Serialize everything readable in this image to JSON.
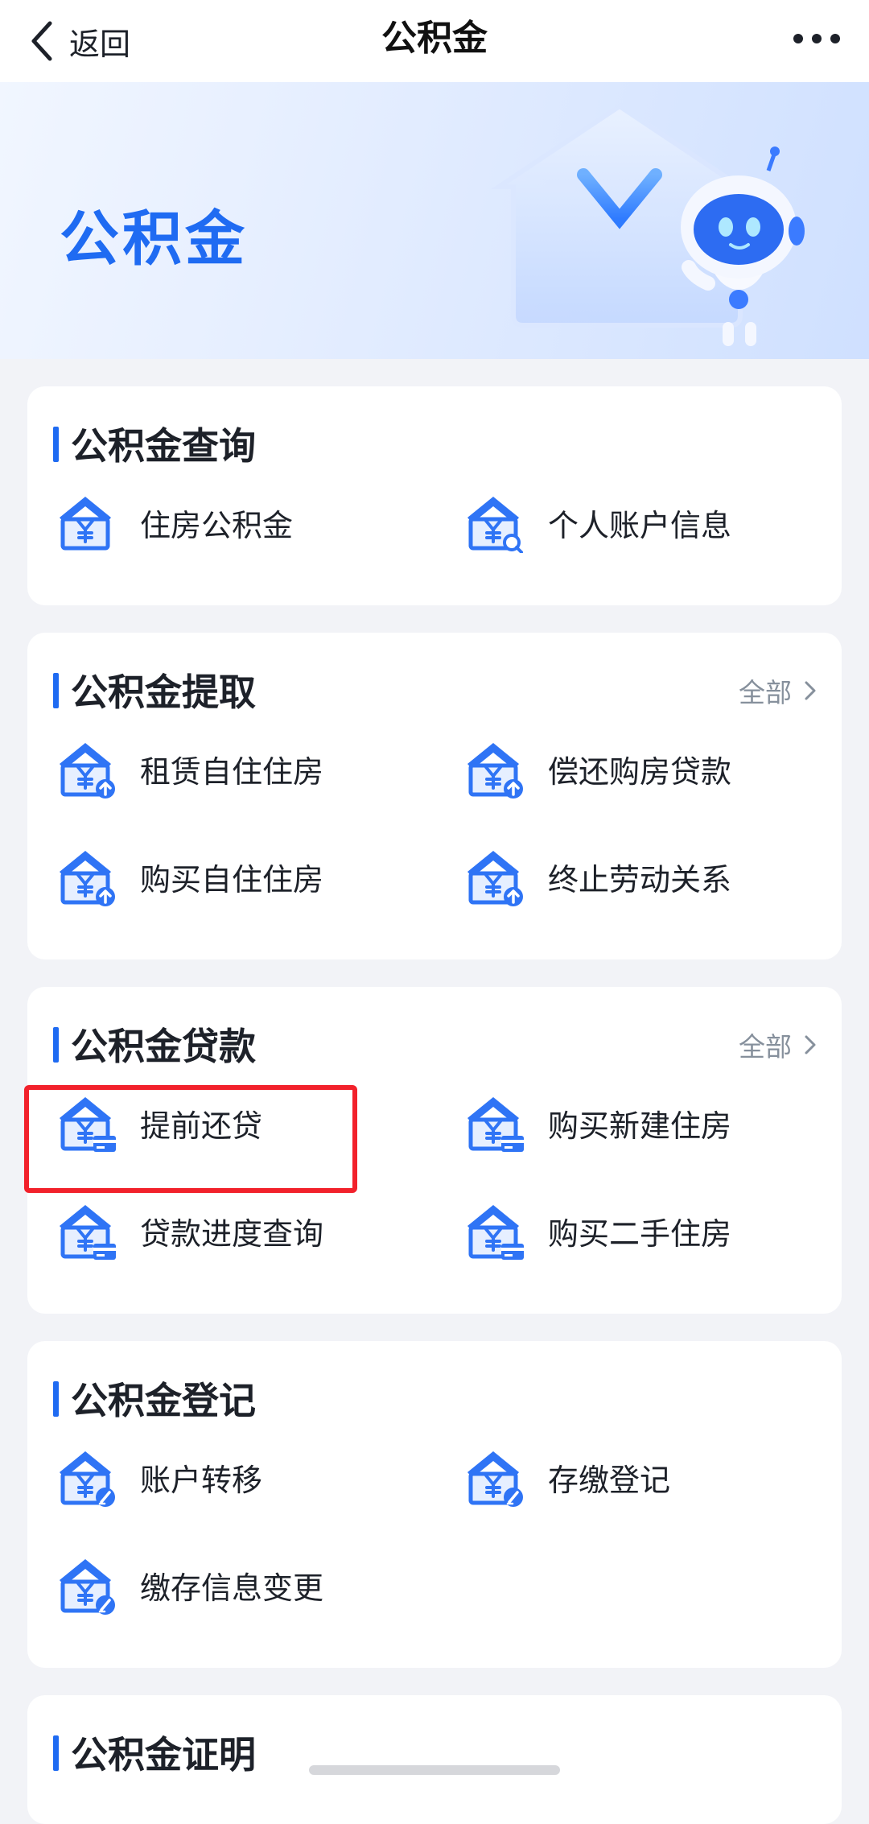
{
  "nav": {
    "back_label": "返回",
    "title": "公积金"
  },
  "banner": {
    "title": "公积金"
  },
  "colors": {
    "accent": "#1f6bf2",
    "highlight": "#f2212b",
    "background": "#f2f3f7"
  },
  "sections": [
    {
      "title": "公积金查询",
      "items": [
        {
          "label": "住房公积金",
          "icon": "house-yuan-icon"
        },
        {
          "label": "个人账户信息",
          "icon": "house-yuan-search-icon"
        }
      ]
    },
    {
      "title": "公积金提取",
      "see_all": "全部",
      "items": [
        {
          "label": "租赁自住住房",
          "icon": "house-yuan-upload-icon"
        },
        {
          "label": "偿还购房贷款",
          "icon": "house-yuan-upload-icon"
        },
        {
          "label": "购买自住住房",
          "icon": "house-yuan-upload-icon"
        },
        {
          "label": "终止劳动关系",
          "icon": "house-yuan-upload-icon"
        }
      ]
    },
    {
      "title": "公积金贷款",
      "see_all": "全部",
      "items": [
        {
          "label": "提前还贷",
          "icon": "house-yuan-card-icon"
        },
        {
          "label": "购买新建住房",
          "icon": "house-yuan-card-icon"
        },
        {
          "label": "贷款进度查询",
          "icon": "house-yuan-card-icon"
        },
        {
          "label": "购买二手住房",
          "icon": "house-yuan-card-icon"
        }
      ]
    },
    {
      "title": "公积金登记",
      "items": [
        {
          "label": "账户转移",
          "icon": "house-yuan-edit-icon"
        },
        {
          "label": "存缴登记",
          "icon": "house-yuan-edit-icon"
        },
        {
          "label": "缴存信息变更",
          "icon": "house-yuan-edit-icon"
        }
      ]
    },
    {
      "title": "公积金证明",
      "items": []
    }
  ]
}
